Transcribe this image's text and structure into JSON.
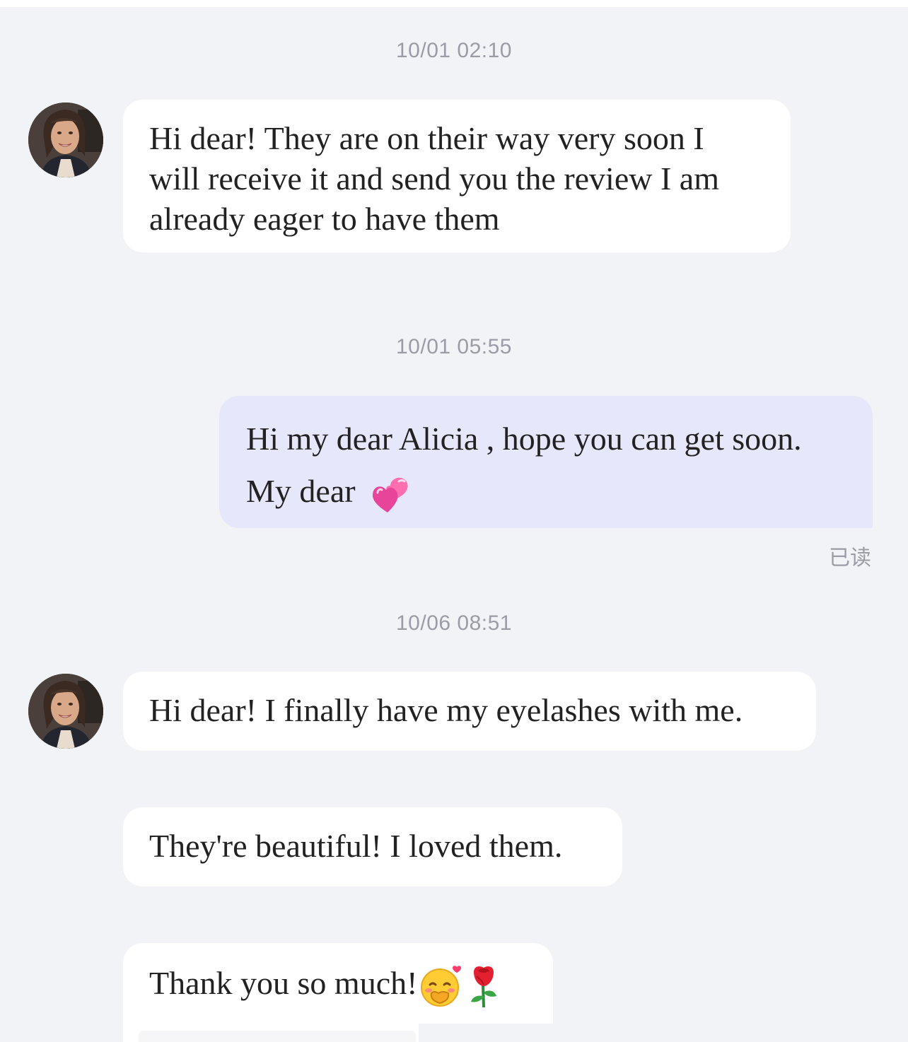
{
  "chat": {
    "messages": [
      {
        "timestamp": "10/01 02:10",
        "sender": "contact",
        "lines": [
          "Hi dear! They are on their way very soon I",
          "will receive it and send you the review I am",
          "already eager to have them"
        ]
      },
      {
        "timestamp": "10/01 05:55",
        "sender": "me",
        "lines": [
          "Hi my dear Alicia , hope you can get soon.",
          "My dear"
        ],
        "emoji": "two-hearts-icon",
        "status": "已读"
      },
      {
        "timestamp": "10/06 08:51",
        "sender": "contact",
        "lines": [
          "Hi dear! I finally have my eyelashes with me."
        ]
      },
      {
        "sender": "contact",
        "lines": [
          "They're beautiful! I loved them."
        ]
      },
      {
        "sender": "contact",
        "lines": [
          "Thank you so much!"
        ],
        "emoji": [
          "blushing-face-icon",
          "rose-icon"
        ]
      }
    ]
  },
  "colors": {
    "background": "#f2f3f7",
    "incoming_bubble": "#ffffff",
    "outgoing_bubble": "#e7e7fb",
    "timestamp_text": "#9a9ca6",
    "message_text": "#222222"
  }
}
